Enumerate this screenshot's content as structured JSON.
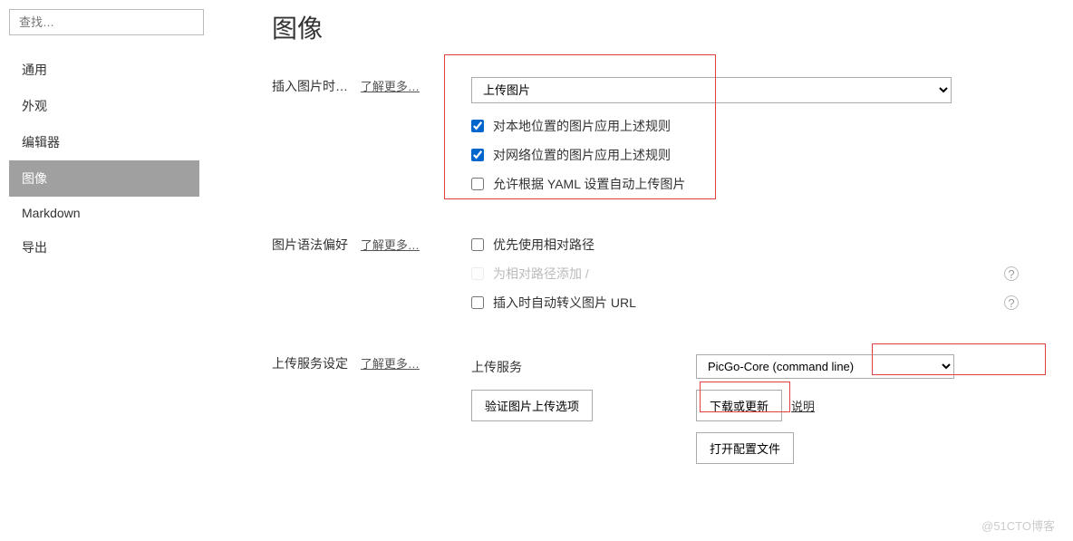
{
  "sidebar": {
    "search_placeholder": "查找…",
    "items": [
      {
        "label": "通用",
        "active": false
      },
      {
        "label": "外观",
        "active": false
      },
      {
        "label": "编辑器",
        "active": false
      },
      {
        "label": "图像",
        "active": true
      },
      {
        "label": "Markdown",
        "active": false
      },
      {
        "label": "导出",
        "active": false
      }
    ]
  },
  "page": {
    "title": "图像"
  },
  "common": {
    "learn_more": "了解更多…"
  },
  "section_insert": {
    "label": "插入图片时…",
    "select_value": "上传图片",
    "check1": {
      "label": "对本地位置的图片应用上述规则",
      "checked": true
    },
    "check2": {
      "label": "对网络位置的图片应用上述规则",
      "checked": true
    },
    "check3": {
      "label": "允许根据 YAML 设置自动上传图片",
      "checked": false
    }
  },
  "section_syntax": {
    "label": "图片语法偏好",
    "check1": {
      "label": "优先使用相对路径",
      "checked": false
    },
    "check2": {
      "label": "为相对路径添加 /",
      "checked": false,
      "disabled": true
    },
    "check3": {
      "label": "插入时自动转义图片 URL",
      "checked": false
    }
  },
  "section_upload": {
    "label": "上传服务设定",
    "service_label": "上传服务",
    "service_value": "PicGo-Core (command line)",
    "verify_button": "验证图片上传选项",
    "download_button": "下载或更新",
    "explain_link": "说明",
    "open_config_button": "打开配置文件"
  },
  "watermark": "@51CTO博客"
}
